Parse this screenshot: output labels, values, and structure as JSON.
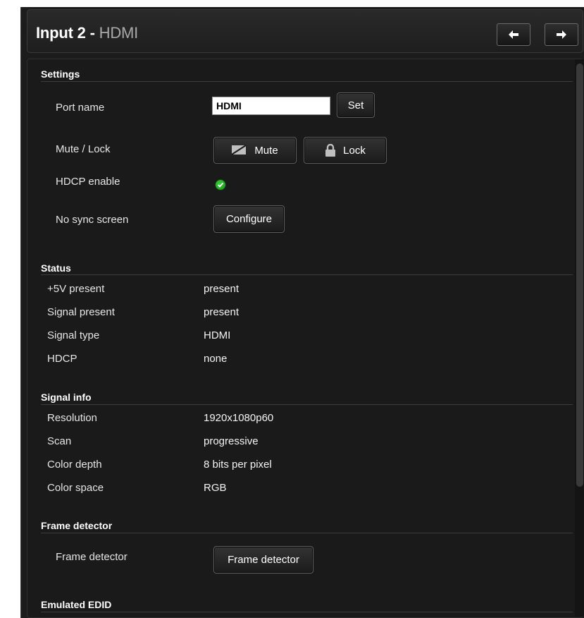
{
  "header": {
    "title": "Input 2",
    "separator": " - ",
    "subtitle": "HDMI",
    "prev_icon": "arrow-left-icon",
    "next_icon": "arrow-right-icon"
  },
  "settings": {
    "heading": "Settings",
    "port_name_label": "Port name",
    "port_name_value": "HDMI",
    "set_label": "Set",
    "mute_lock_label": "Mute / Lock",
    "mute_label": "Mute",
    "lock_label": "Lock",
    "hdcp_label": "HDCP enable",
    "hdcp_enabled": true,
    "no_sync_label": "No sync screen",
    "configure_label": "Configure"
  },
  "status": {
    "heading": "Status",
    "rows": [
      {
        "label": "+5V present",
        "value": "present"
      },
      {
        "label": "Signal present",
        "value": "present"
      },
      {
        "label": "Signal type",
        "value": "HDMI"
      },
      {
        "label": "HDCP",
        "value": "none"
      }
    ]
  },
  "signal_info": {
    "heading": "Signal info",
    "rows": [
      {
        "label": "Resolution",
        "value": "1920x1080p60"
      },
      {
        "label": "Scan",
        "value": "progressive"
      },
      {
        "label": "Color depth",
        "value": "8 bits per pixel"
      },
      {
        "label": "Color space",
        "value": "RGB"
      }
    ]
  },
  "frame_detector": {
    "heading": "Frame detector",
    "label": "Frame detector",
    "button_label": "Frame detector"
  },
  "emulated_edid": {
    "heading": "Emulated EDID"
  },
  "colors": {
    "background": "#1c1c1c",
    "accent_green": "#2fbf2f",
    "text": "#f0f0f0"
  }
}
